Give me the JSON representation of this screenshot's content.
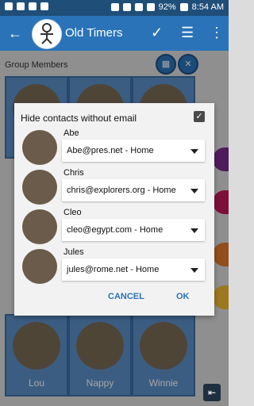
{
  "status": {
    "battery": "92%",
    "time": "8:54 AM"
  },
  "appbar": {
    "title": "Old Timers"
  },
  "section": {
    "label": "Group Members"
  },
  "grid": {
    "names": [
      "Lou",
      "Nappy",
      "Winnie"
    ]
  },
  "dialog": {
    "header": "Hide contacts without email",
    "rows": [
      {
        "name": "Abe",
        "email": "Abe@pres.net - Home"
      },
      {
        "name": "Chris",
        "email": "chris@explorers.org - Home"
      },
      {
        "name": "Cleo",
        "email": "cleo@egypt.com - Home"
      },
      {
        "name": "Jules",
        "email": "jules@rome.net - Home"
      }
    ],
    "buttons": {
      "cancel": "CANCEL",
      "ok": "OK"
    }
  },
  "colors": {
    "appbar": "#2a73b8",
    "statusbar": "#1f4e79",
    "cell": "#5b8fc8"
  },
  "icons": {
    "back": "back-arrow-icon",
    "check": "check-icon",
    "list": "list-icon",
    "more": "more-vert-icon"
  }
}
